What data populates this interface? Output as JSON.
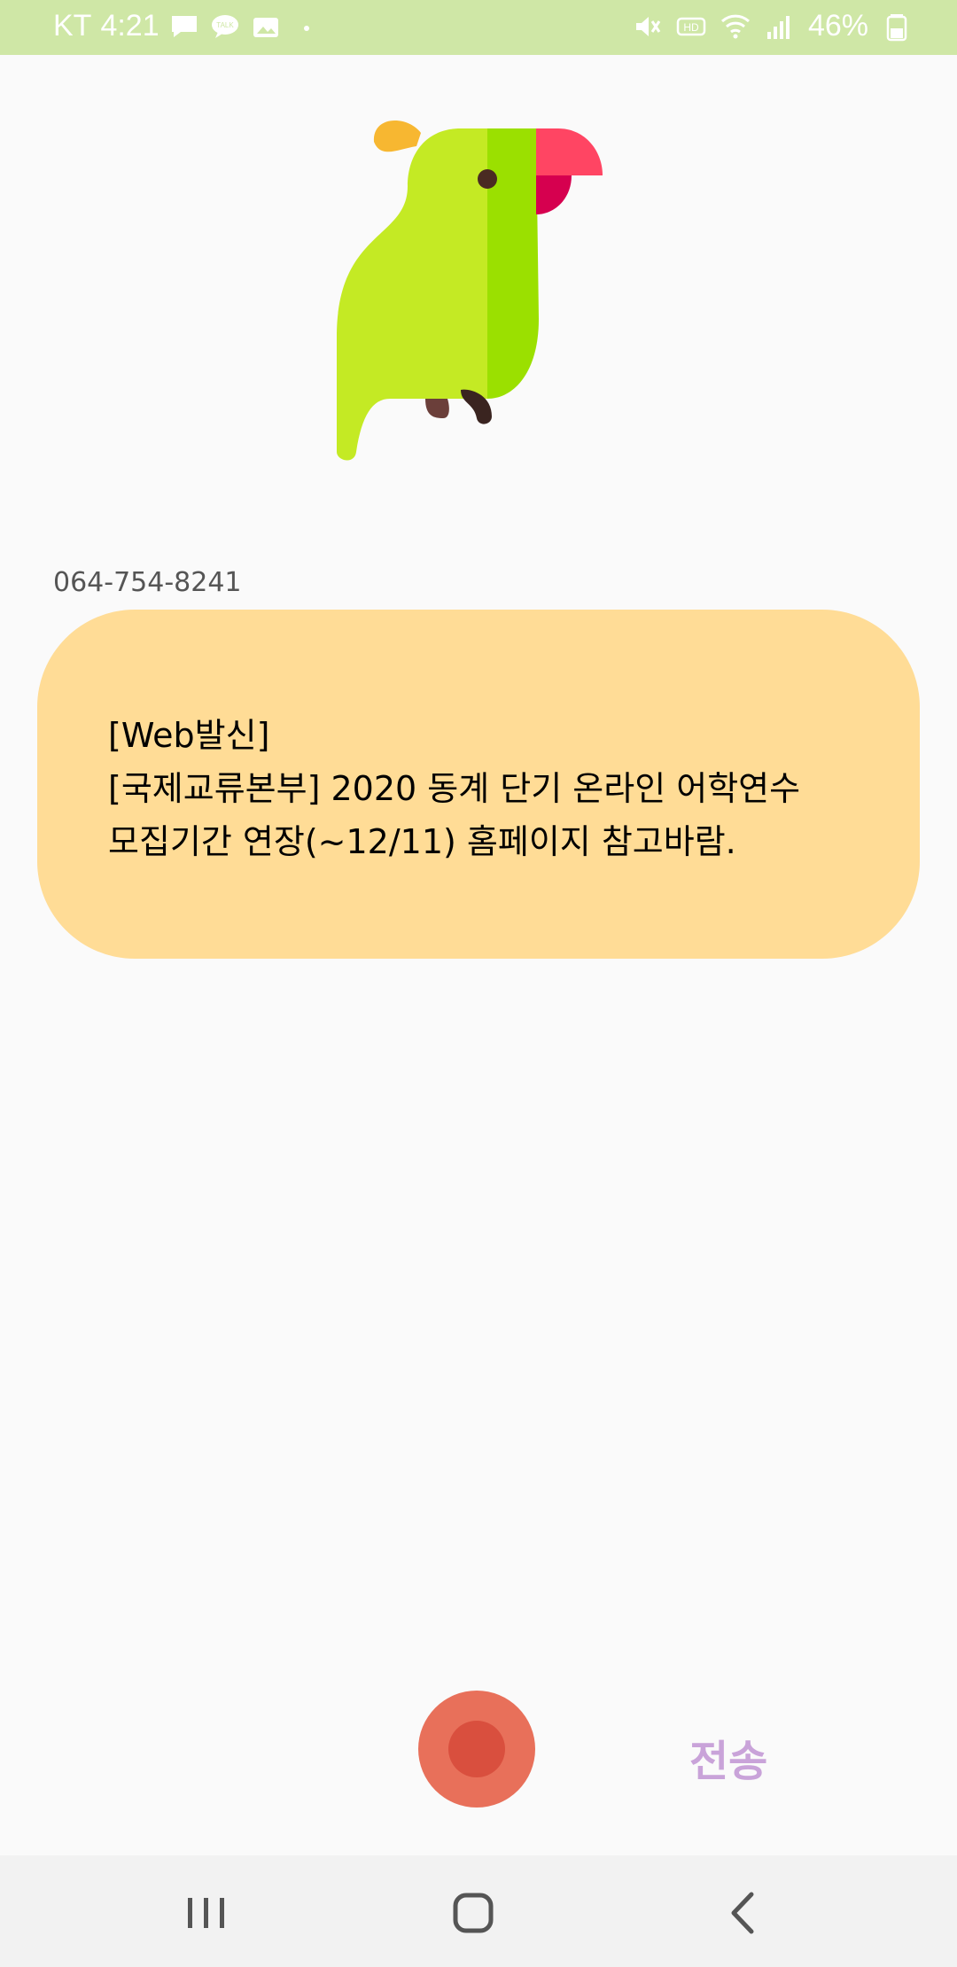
{
  "status_bar": {
    "carrier": "KT",
    "time": "4:21",
    "left_icons": [
      "message-icon",
      "kakaotalk-icon",
      "gallery-icon",
      "dot-icon"
    ],
    "right_icons": [
      "mute-icon",
      "hd-icon",
      "wifi-icon",
      "signal-icon"
    ],
    "battery": "46%",
    "bg_color": "#cfe7a6"
  },
  "header": {
    "logo_icon": "parrot-icon"
  },
  "message": {
    "sender": "064-754-8241",
    "lines": [
      "[Web발신]",
      "[국제교류본부] 2020 동계 단기 온라인 어학연수",
      "모집기간 연장(~12/11) 홈페이지 참고바람."
    ],
    "bubble_color": "#ffdc96"
  },
  "controls": {
    "record_icon": "record-icon",
    "send_label": "전송",
    "record_color": "#e8705a",
    "send_color": "#c9a3d9"
  },
  "navigation": {
    "recents_icon": "recents-icon",
    "home_icon": "home-icon",
    "back_icon": "back-icon"
  }
}
